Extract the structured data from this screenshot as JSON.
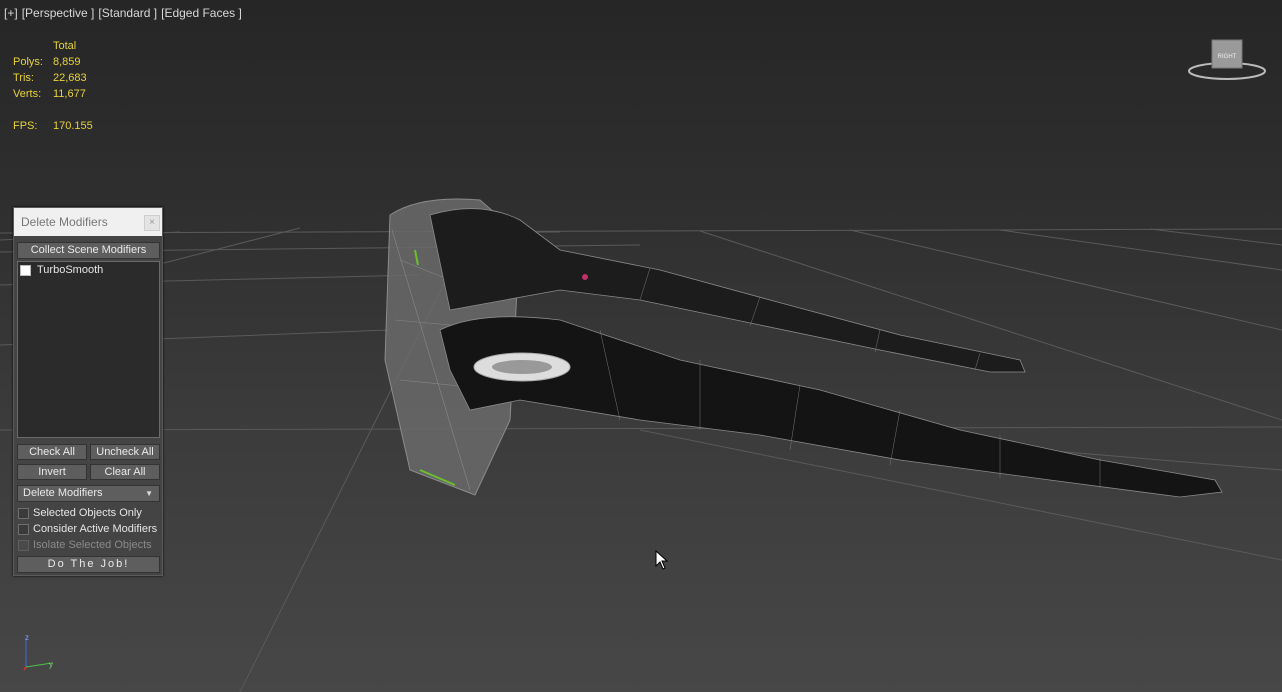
{
  "viewport": {
    "label_parts": [
      "[+]",
      "[Perspective ]",
      "[Standard ]",
      "[Edged Faces ]"
    ],
    "stats": {
      "header": "Total",
      "rows": [
        {
          "key": "Polys:",
          "value": "8,859"
        },
        {
          "key": "Tris:",
          "value": "22,683"
        },
        {
          "key": "Verts:",
          "value": "11,677"
        }
      ],
      "fps_label": "FPS:",
      "fps_value": "170.155"
    },
    "viewcube_label": "RIGHT",
    "axis": {
      "z": "z",
      "y": "y"
    }
  },
  "dialog": {
    "title": "Delete Modifiers",
    "collect_button": "Collect Scene Modifiers",
    "modifiers": [
      {
        "label": "TurboSmooth",
        "checked": false
      }
    ],
    "check_all": "Check All",
    "uncheck_all": "Uncheck All",
    "invert": "Invert",
    "clear_all": "Clear All",
    "mode_selected": "Delete Modifiers",
    "options": [
      {
        "label": "Selected Objects Only",
        "checked": false,
        "enabled": true
      },
      {
        "label": "Consider Active Modifiers",
        "checked": false,
        "enabled": true
      },
      {
        "label": "Isolate Selected Objects",
        "checked": false,
        "enabled": false
      }
    ],
    "do_button": "Do The Job!"
  },
  "colors": {
    "stats_yellow": "#e8d23b",
    "viewport_bg": "#333333",
    "panel_bg": "#444444"
  }
}
